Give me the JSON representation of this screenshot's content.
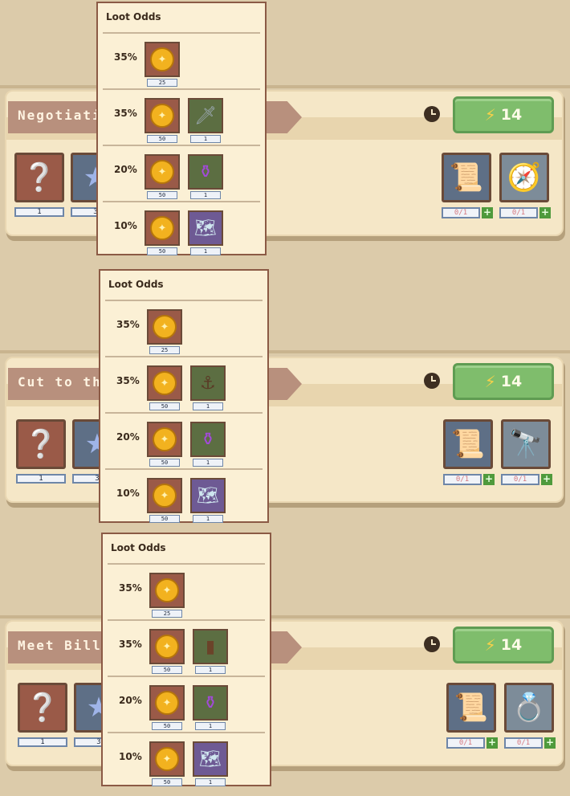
{
  "popup_title": "Loot Odds",
  "quests": [
    {
      "title": "Negotiati",
      "energy": "14",
      "slot_counts": [
        "1",
        "3"
      ],
      "requirements": [
        {
          "icon": "map-scroll-icon",
          "progress": "0/1"
        },
        {
          "icon": "compass-icon",
          "progress": "0/1"
        }
      ],
      "loot": [
        {
          "pct": "35%",
          "coin": "25",
          "item": null
        },
        {
          "pct": "35%",
          "coin": "50",
          "item": {
            "icon": "dagger-icon",
            "qty": "1"
          }
        },
        {
          "pct": "20%",
          "coin": "50",
          "item": {
            "icon": "potion-icon",
            "qty": "1"
          }
        },
        {
          "pct": "10%",
          "coin": "50",
          "item": {
            "icon": "treasure-map-icon",
            "qty": "1"
          }
        }
      ]
    },
    {
      "title": "Cut to the",
      "energy": "14",
      "slot_counts": [
        "1",
        "3"
      ],
      "requirements": [
        {
          "icon": "map-scroll-icon",
          "progress": "0/1"
        },
        {
          "icon": "spyglass-icon",
          "progress": "0/1"
        }
      ],
      "loot": [
        {
          "pct": "35%",
          "coin": "25",
          "item": null
        },
        {
          "pct": "35%",
          "coin": "50",
          "item": {
            "icon": "hook-icon",
            "qty": "1"
          }
        },
        {
          "pct": "20%",
          "coin": "50",
          "item": {
            "icon": "potion-icon",
            "qty": "1"
          }
        },
        {
          "pct": "10%",
          "coin": "50",
          "item": {
            "icon": "treasure-map-icon",
            "qty": "1"
          }
        }
      ]
    },
    {
      "title": "Meet Billy",
      "energy": "14",
      "slot_counts": [
        "1",
        "3"
      ],
      "requirements": [
        {
          "icon": "map-scroll-icon",
          "progress": "0/1"
        },
        {
          "icon": "gem-ring-icon",
          "progress": "0/1"
        }
      ],
      "loot": [
        {
          "pct": "35%",
          "coin": "25",
          "item": null
        },
        {
          "pct": "35%",
          "coin": "50",
          "item": {
            "icon": "wooden-leg-icon",
            "qty": "1"
          }
        },
        {
          "pct": "20%",
          "coin": "50",
          "item": {
            "icon": "potion-icon",
            "qty": "1"
          }
        },
        {
          "pct": "10%",
          "coin": "50",
          "item": {
            "icon": "treasure-map-icon",
            "qty": "1"
          }
        }
      ]
    }
  ]
}
